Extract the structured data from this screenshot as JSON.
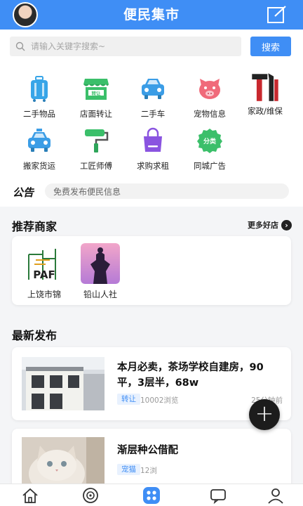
{
  "header": {
    "title": "便民集市"
  },
  "search": {
    "placeholder": "请输入关键字搜索~",
    "button_label": "搜索"
  },
  "categories": [
    {
      "label": "二手物品",
      "icon": "luggage-icon",
      "color": "#37a5e8"
    },
    {
      "label": "店面转让",
      "icon": "storefront-icon",
      "color": "#3bbf6a"
    },
    {
      "label": "二手车",
      "icon": "car-icon",
      "color": "#3b9de6"
    },
    {
      "label": "宠物信息",
      "icon": "pig-icon",
      "color": "#f06a7a"
    },
    {
      "label": "家政/维保",
      "icon": "tools-icon",
      "color": "#c8282e"
    },
    {
      "label": "搬家货运",
      "icon": "taxi-icon",
      "color": "#3b9de6"
    },
    {
      "label": "工匠师傅",
      "icon": "paint-roller-icon",
      "color": "#3bbf6a"
    },
    {
      "label": "求购求租",
      "icon": "shopping-bag-icon",
      "color": "#8a54e0"
    },
    {
      "label": "同城广告",
      "icon": "ad-badge-icon",
      "color": "#3bbf6a"
    }
  ],
  "notice": {
    "label": "公告",
    "text": "免费发布便民信息"
  },
  "merchants": {
    "title": "推荐商家",
    "more_label": "更多好店",
    "items": [
      {
        "name": "上饶市锦",
        "logo_text": "PAF"
      },
      {
        "name": "铅山人社"
      }
    ]
  },
  "latest": {
    "title": "最新发布",
    "posts": [
      {
        "title": "本月必卖，茶场学校自建房，90平，3层半，68w",
        "tag": "转让",
        "views": "10002浏览",
        "time": "25分钟前"
      },
      {
        "title": "渐层种公借配",
        "tag": "宠猫",
        "views": "12浏"
      }
    ]
  },
  "fab": {
    "label": "+"
  },
  "colors": {
    "brand": "#3f8ef5",
    "fab": "#1c1c1c"
  }
}
